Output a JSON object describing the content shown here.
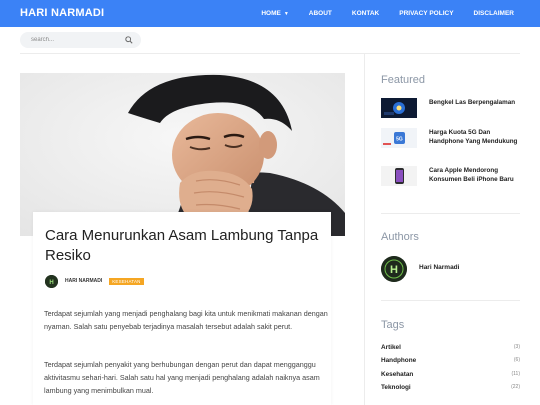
{
  "header": {
    "brand": "HARI NARMADI",
    "nav": [
      {
        "label": "HOME",
        "has_dropdown": true
      },
      {
        "label": "ABOUT"
      },
      {
        "label": "KONTAK"
      },
      {
        "label": "PRIVACY POLICY"
      },
      {
        "label": "DISCLAIMER"
      }
    ],
    "accent_color": "#3b82f6"
  },
  "search": {
    "placeholder": "search...",
    "icon": "search-icon"
  },
  "article": {
    "title": "Cara Menurunkan Asam Lambung Tanpa Resiko",
    "author": "HARI NARMADI",
    "category": "KESEHATAN",
    "image_alt": "man-coughing-photo",
    "paragraphs": [
      "Terdapat sejumlah yang menjadi penghalang bagi kita untuk menikmati makanan dengan nyaman. Salah satu penyebab terjadinya masalah tersebut adalah sakit perut.",
      "Terdapat sejumlah penyakit yang berhubungan dengan perut dan dapat mengganggu aktivitasmu sehari-hari. Salah satu hal yang menjadi penghalang adalah naiknya asam lambung yang menimbulkan mual."
    ]
  },
  "sidebar": {
    "featured_heading": "Featured",
    "featured": [
      {
        "title": "Bengkel Las Berpengalaman"
      },
      {
        "title": "Harga Kuota 5G Dan Handphone Yang Mendukung"
      },
      {
        "title": "Cara Apple Mendorong Konsumen Beli iPhone Baru"
      }
    ],
    "authors_heading": "Authors",
    "author_name": "Hari Narmadi",
    "tags_heading": "Tags",
    "tags": [
      {
        "name": "Artikel",
        "count": "(3)"
      },
      {
        "name": "Handphone",
        "count": "(6)"
      },
      {
        "name": "Kesehatan",
        "count": "(11)"
      },
      {
        "name": "Teknologi",
        "count": "(22)"
      }
    ]
  }
}
